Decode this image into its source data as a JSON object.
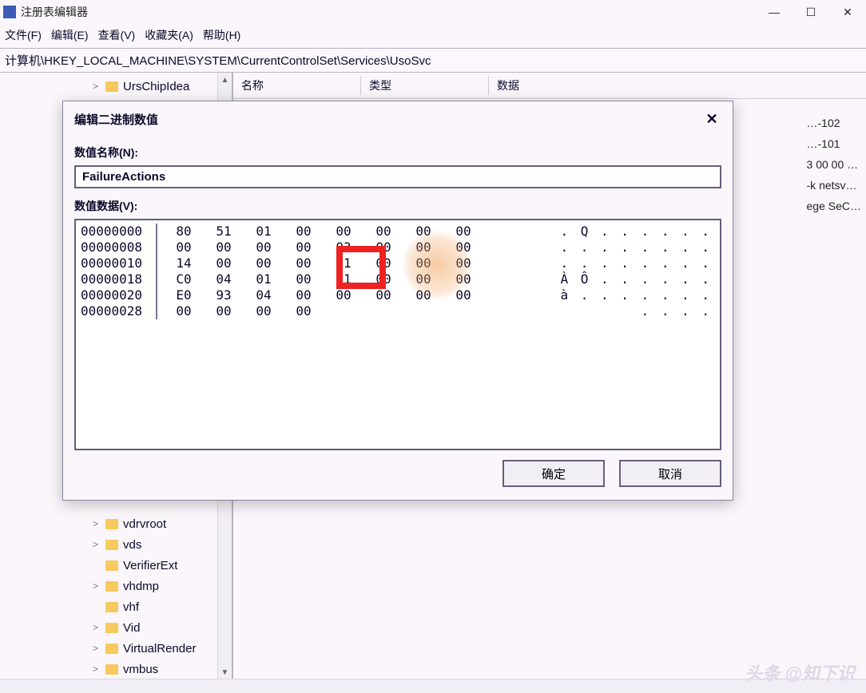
{
  "app": {
    "title": "注册表编辑器",
    "path": "计算机\\HKEY_LOCAL_MACHINE\\SYSTEM\\CurrentControlSet\\Services\\UsoSvc"
  },
  "menu": {
    "file": "文件(F)",
    "edit": "编辑(E)",
    "view": "查看(V)",
    "favorites": "收藏夹(A)",
    "help": "帮助(H)"
  },
  "window_controls": {
    "minimize": "—",
    "maximize": "☐",
    "close": "✕"
  },
  "columns": {
    "name": "名称",
    "type": "类型",
    "data": "数据"
  },
  "tree_top": [
    {
      "label": "UrsChipIdea",
      "arrow": ">"
    }
  ],
  "tree_bottom": [
    {
      "label": "vdrvroot",
      "arrow": ">"
    },
    {
      "label": "vds",
      "arrow": ">"
    },
    {
      "label": "VerifierExt",
      "arrow": ""
    },
    {
      "label": "vhdmp",
      "arrow": ">"
    },
    {
      "label": "vhf",
      "arrow": ""
    },
    {
      "label": "Vid",
      "arrow": ">"
    },
    {
      "label": "VirtualRender",
      "arrow": ">"
    },
    {
      "label": "vmbus",
      "arrow": ">"
    }
  ],
  "bg_values": [
    "…-102",
    "…-101",
    "",
    "3 00 00 …",
    "-k netsv…",
    "",
    "",
    "",
    "ege SeC…"
  ],
  "dialog": {
    "title": "编辑二进制数值",
    "close": "✕",
    "name_label": "数值名称(N):",
    "name_value": "FailureActions",
    "data_label": "数值数据(V):",
    "ok": "确定",
    "cancel": "取消",
    "hex_rows": [
      {
        "addr": "00000000",
        "bytes": [
          "80",
          "51",
          "01",
          "00",
          "00",
          "00",
          "00",
          "00"
        ],
        "ascii": ". Q . . . . . ."
      },
      {
        "addr": "00000008",
        "bytes": [
          "00",
          "00",
          "00",
          "00",
          "03",
          "00",
          "00",
          "00"
        ],
        "ascii": ". . . . . . . ."
      },
      {
        "addr": "00000010",
        "bytes": [
          "14",
          "00",
          "00",
          "00",
          "01",
          "00",
          "00",
          "00"
        ],
        "ascii": ". . . . . . . ."
      },
      {
        "addr": "00000018",
        "bytes": [
          "C0",
          "04",
          "01",
          "00",
          "01",
          "00",
          "00",
          "00"
        ],
        "ascii": "À Ô . . . . . ."
      },
      {
        "addr": "00000020",
        "bytes": [
          "E0",
          "93",
          "04",
          "00",
          "00",
          "00",
          "00",
          "00"
        ],
        "ascii": "à . . . . . . ."
      },
      {
        "addr": "00000028",
        "bytes": [
          "00",
          "00",
          "00",
          "00"
        ],
        "ascii": ". . . ."
      }
    ]
  },
  "watermark": "头条 @知下识"
}
